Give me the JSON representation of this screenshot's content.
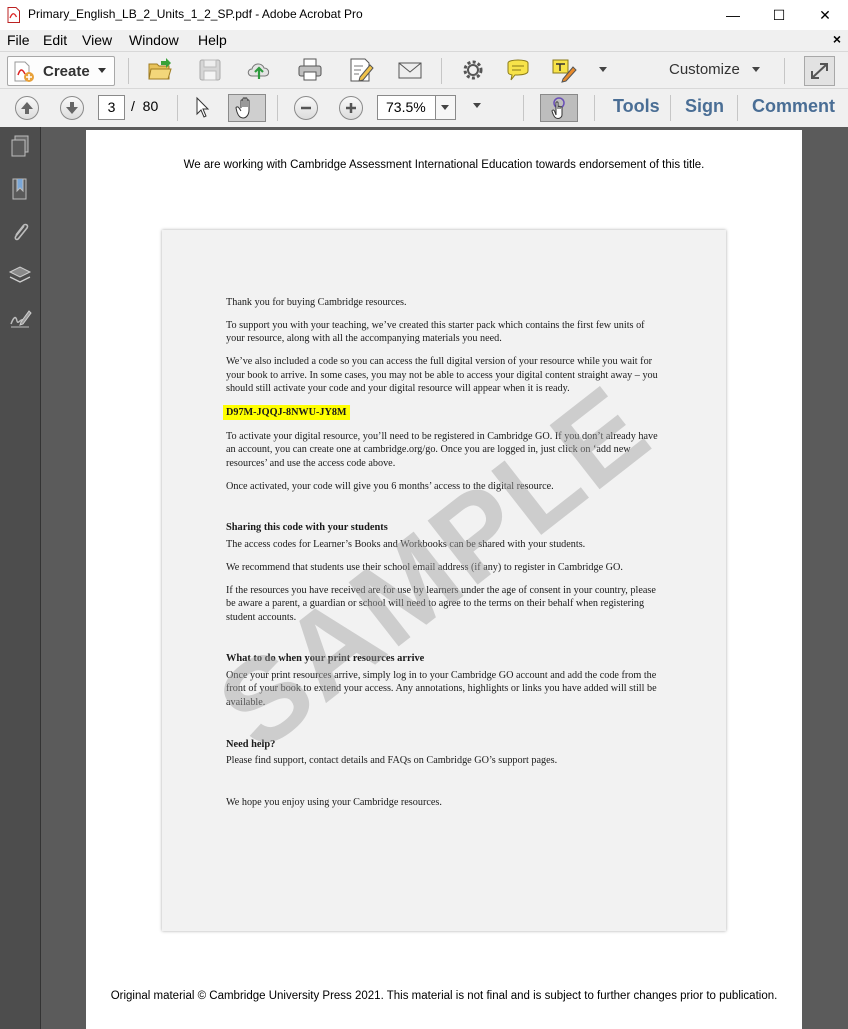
{
  "window": {
    "title": "Primary_English_LB_2_Units_1_2_SP.pdf - Adobe Acrobat Pro",
    "minimize": "—",
    "maximize": "☐",
    "close": "✕"
  },
  "menu": {
    "items": [
      "File",
      "Edit",
      "View",
      "Window",
      "Help"
    ],
    "close_doc": "×"
  },
  "toolbar": {
    "create_label": "Create",
    "customize_label": "Customize",
    "icons": [
      "open-icon",
      "save-icon",
      "cloud-upload-icon",
      "print-icon",
      "edit-icon",
      "email-icon",
      "settings-icon",
      "comment-icon",
      "highlight-icon"
    ]
  },
  "nav": {
    "current_page": "3",
    "separator": "/",
    "total_pages": "80",
    "zoom": "73.5%",
    "tools_label": "Tools",
    "sign_label": "Sign",
    "comment_label": "Comment"
  },
  "leftnav": {
    "icons": [
      "pages-icon",
      "bookmarks-icon",
      "attachments-icon",
      "layers-icon",
      "signatures-icon"
    ]
  },
  "document": {
    "endorsement": "We are working with Cambridge Assessment International Education towards endorsement of this title.",
    "p1": "Thank you for buying Cambridge resources.",
    "p2": "To support you with your teaching, we’ve created this starter pack which contains the first few units of your resource, along with all the accompanying materials you need.",
    "p3": "We’ve also included a code so you can access the full digital version of your resource while you wait for your book to arrive. In some cases, you may not be able to access your digital content straight away – you should still activate your code and your digital resource will appear when it is ready.",
    "code": "D97M-JQQJ-8NWU-JY8M",
    "p4": "To activate your digital resource, you’ll need to be registered in Cambridge GO. If you don’t already have an account, you can create one at cambridge.org/go. Once you are logged in, just click on ‘add new resources’ and use the access code above.",
    "p5": "Once activated, your code will give you 6 months’ access to the digital resource.",
    "h_sharing": "Sharing this code with your students",
    "p6": "The access codes for Learner’s Books and Workbooks can be shared with your students.",
    "p7": "We recommend that students use their school email address (if any) to register in Cambridge GO.",
    "p8": "If the resources you have received are for use by learners under the age of consent in your country, please be aware a parent, a guardian or school will need to agree to the terms on their behalf when registering student accounts.",
    "h_print": "What to do when your print resources arrive",
    "p9": "Once your print resources arrive, simply log in to your Cambridge GO account and add the code from the front of your book to extend your access. Any annotations, highlights or links you have added will still be available.",
    "h_help": "Need help?",
    "p10": "Please find support, contact details and FAQs on Cambridge GO’s support pages.",
    "p11": "We hope you enjoy using your Cambridge resources.",
    "watermark": "SAMPLE",
    "footer": "Original material © Cambridge University Press 2021. This material is not final and is subject to further changes prior to publication."
  },
  "colors": {
    "link_blue": "#4a6e95",
    "highlight": "#ffff00",
    "doc_background": "#5b5b5b"
  }
}
